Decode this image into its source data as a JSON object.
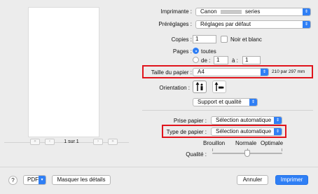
{
  "preview": {
    "first_icon": "double-chevron-left-icon",
    "prev_icon": "chevron-left-icon",
    "page_label": "1 sur 1",
    "next_icon": "chevron-right-icon",
    "last_icon": "double-chevron-right-icon"
  },
  "printer": {
    "label": "Imprimante :",
    "value_prefix": "Canon",
    "value_suffix": "series"
  },
  "presets": {
    "label": "Préréglages :",
    "value": "Réglages par défaut"
  },
  "copies": {
    "label": "Copies :",
    "value": "1",
    "bw_label": "Noir et blanc"
  },
  "pages": {
    "label": "Pages :",
    "all_label": "toutes",
    "from_label": "de :",
    "from_value": "1",
    "to_label": "à :",
    "to_value": "1"
  },
  "paper_size": {
    "label": "Taille du papier :",
    "value": "A4",
    "dimensions": "210 par 297 mm"
  },
  "orientation": {
    "label": "Orientation :",
    "portrait_icon": "portrait-orientation-icon",
    "landscape_icon": "landscape-orientation-icon"
  },
  "section": {
    "value": "Support et qualité"
  },
  "paper_source": {
    "label": "Prise papier :",
    "value": "Sélection automatique"
  },
  "media_type": {
    "label": "Type de papier :",
    "value": "Sélection automatique"
  },
  "quality": {
    "label": "Qualité :",
    "draft": "Brouillon",
    "normal": "Normale",
    "best": "Optimale",
    "level_fraction": 0.5
  },
  "footer": {
    "help": "?",
    "pdf": "PDF",
    "hide_details": "Masquer les détails",
    "cancel": "Annuler",
    "print": "Imprimer"
  },
  "colors": {
    "accent": "#2f7ff5",
    "highlight": "#e0141c"
  }
}
